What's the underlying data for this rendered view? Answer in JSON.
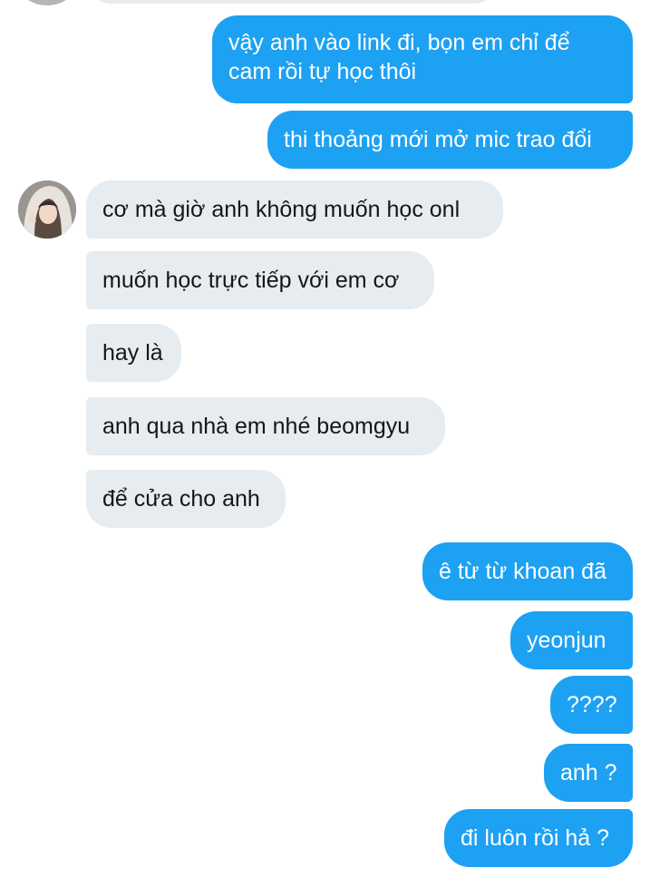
{
  "conversation": {
    "messages": [
      {
        "sender": "me",
        "text": "vậy anh vào link đi, bọn em chỉ để cam rồi tự học thôi"
      },
      {
        "sender": "me",
        "text": "thi thoảng mới mở mic trao đổi"
      },
      {
        "sender": "them",
        "text": "cơ mà giờ anh không muốn học onl"
      },
      {
        "sender": "them",
        "text": "muốn học trực tiếp với em cơ"
      },
      {
        "sender": "them",
        "text": "hay là"
      },
      {
        "sender": "them",
        "text": "anh qua nhà em nhé beomgyu"
      },
      {
        "sender": "them",
        "text": "để cửa cho anh"
      },
      {
        "sender": "me",
        "text": "ê từ từ khoan đã"
      },
      {
        "sender": "me",
        "text": "yeonjun"
      },
      {
        "sender": "me",
        "text": "????"
      },
      {
        "sender": "me",
        "text": "anh ?"
      },
      {
        "sender": "me",
        "text": "đi luôn rồi hả ?"
      }
    ]
  },
  "colors": {
    "sent_bubble": "#1da1f2",
    "received_bubble": "#e6ecf0",
    "sent_text": "#ffffff",
    "received_text": "#14171a"
  }
}
